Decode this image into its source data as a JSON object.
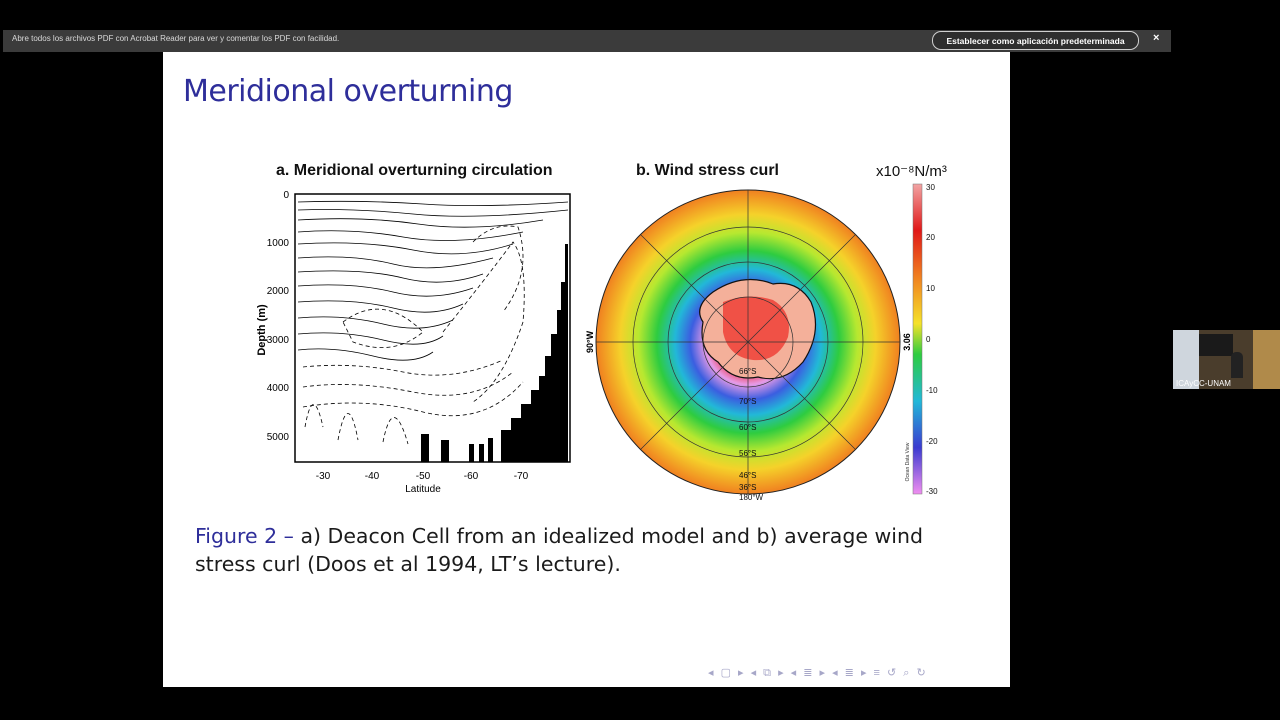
{
  "notification_bar": {
    "message": "Abre todos los archivos PDF con Acrobat Reader para ver y comentar los PDF con facilidad.",
    "button_label": "Establecer como aplicación predeterminada",
    "close_glyph": "×"
  },
  "slide": {
    "title": "Meridional overturning",
    "panel_a": {
      "title": "a. Meridional overturning circulation",
      "ylabel": "Depth (m)",
      "xlabel": "Latitude",
      "y_ticks": [
        "0",
        "1000",
        "2000",
        "3000",
        "4000",
        "5000"
      ],
      "x_ticks": [
        "-30",
        "-40",
        "-50",
        "-60",
        "-70"
      ]
    },
    "panel_b": {
      "title": "b. Wind stress curl",
      "units": "x10⁻⁸N/m³",
      "colorbar_ticks": [
        "30",
        "20",
        "10",
        "0",
        "-10",
        "-20",
        "-30"
      ],
      "lon_left": "90°W",
      "lon_right": "3.06",
      "lat_labels": [
        "66°S",
        "70°S",
        "60°S",
        "56°S",
        "46°S",
        "36°S"
      ],
      "bottom_label": "180°W",
      "watermark": "Ocean Data View"
    },
    "caption_label": "Figure 2 –",
    "caption_text": "a) Deacon Cell from an idealized model and b) average wind stress curl (Doos et al 1994, LT’s lecture).",
    "nav_glyphs": "◂ ▢ ▸ ◂ ⧉ ▸ ◂ ≣ ▸ ◂ ≣ ▸ ≡ ↺ ⌕ ↻"
  },
  "webcam": {
    "label": "ICAyCC-UNAM"
  }
}
